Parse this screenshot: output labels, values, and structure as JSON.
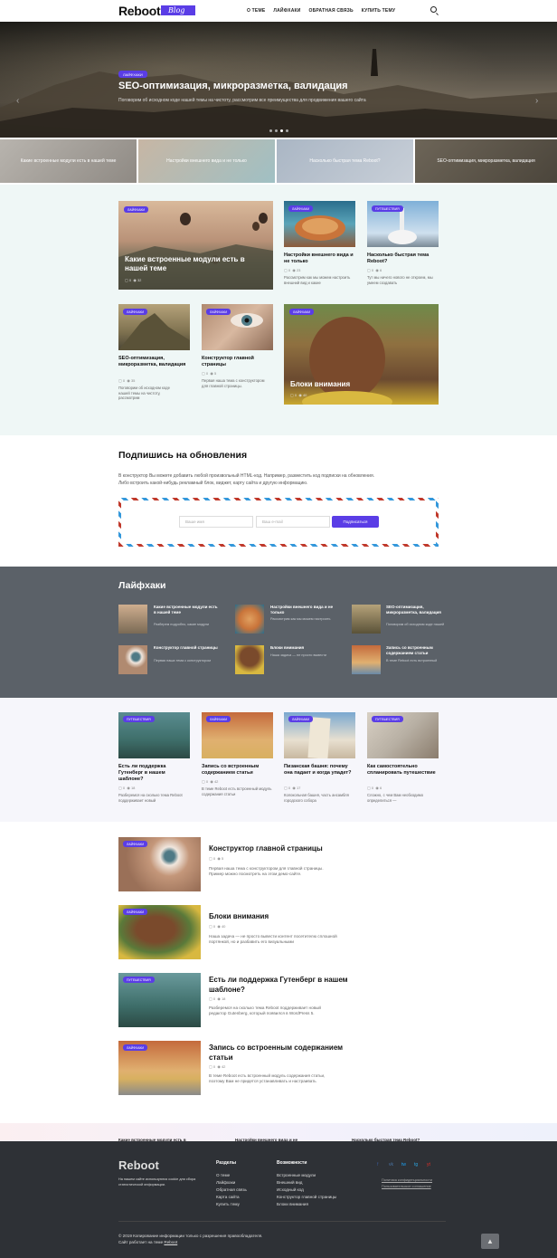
{
  "header": {
    "logo": "Reboot",
    "logo_badge": "Blog",
    "nav": [
      "О теме",
      "Лайфхаки",
      "Обратная связь",
      "Купить тему"
    ]
  },
  "hero": {
    "tag": "Лайфхаки",
    "title": "SEO-оптимизация, микроразметка, валидация",
    "subtitle": "Поговорим об исходном коде нашей темы на чистоту, рассмотрим все преимущества для продвижения вашего сайта",
    "prev": "‹",
    "next": "›"
  },
  "strip": [
    "Какие встроенные модули есть в нашей теме",
    "Настройки внешнего вида и не только",
    "Насколько быстрая тема Reboot?",
    "SEO-оптимизация, микроразметка, валидация"
  ],
  "grid": {
    "big1": {
      "tag": "Лайфхаки",
      "title": "Какие встроенные модули есть в нашей теме",
      "comments": "0",
      "views": "32"
    },
    "c1": {
      "tag": "Лайфхаки",
      "title": "Настройки внешнего вида и не только",
      "comments": "0",
      "views": "23",
      "desc": "Рассмотрим как мы можем настроить внешний вид и какие"
    },
    "c2": {
      "tag": "Путешествия",
      "title": "Насколько быстрая тема Reboot?",
      "comments": "0",
      "views": "6",
      "desc": "Тут мы ничего нового не откроем, мы умеем создавать"
    },
    "c3": {
      "tag": "Лайфхаки",
      "title": "SEO-оптимизация, микроразметка, валидация",
      "comments": "0",
      "views": "35",
      "desc": "Поговорим об исходном коде нашей темы на чистоту, рассмотрим"
    },
    "c4": {
      "tag": "Лайфхаки",
      "title": "Конструктор главной страницы",
      "comments": "0",
      "views": "5",
      "desc": "Первая наша тема с конструктором для главной страницы."
    },
    "big2": {
      "tag": "Лайфхаки",
      "title": "Блоки внимания",
      "comments": "0",
      "views": "40"
    }
  },
  "subscribe": {
    "title": "Подпишись на обновления",
    "text1": "В конструктор Вы можете добавить любой произвольный HTML-код. Например, разместить код подписки на обновления.",
    "text2": "Либо встроить какой-нибудь рекламный блок, виджет, карту сайта и другую информацию.",
    "name_placeholder": "Ваше имя",
    "email_placeholder": "Ваш e-mail",
    "button": "Подписаться"
  },
  "lifehacks": {
    "title": "Лайфхаки",
    "items": [
      {
        "title": "Какие встроенные модули есть в нашей теме",
        "desc": "Разберем подробно, какие модули"
      },
      {
        "title": "Настройки внешнего вида и не только",
        "desc": "Рассмотрим как мы можем настроить"
      },
      {
        "title": "SEO-оптимизация, микроразметка, валидация",
        "desc": "Поговорим об исходном коде нашей"
      },
      {
        "title": "Конструктор главной страницы",
        "desc": "Первая наша тема с конструктором"
      },
      {
        "title": "Блоки внимания",
        "desc": "Наша задача — не просто вывести"
      },
      {
        "title": "Запись со встроенным содержанием статьи",
        "desc": "В теме Reboot есть встроенный"
      }
    ]
  },
  "row4": [
    {
      "tag": "Путешествия",
      "title": "Есть ли поддержка Гутенберг в нашем шаблоне?",
      "comments": "0",
      "views": "18",
      "desc": "Разберемся на сколько тема Reboot поддерживает новый"
    },
    {
      "tag": "Лайфхаки",
      "title": "Запись со встроенным содержанием статьи",
      "comments": "0",
      "views": "42",
      "desc": "В теме Reboot есть встроенный модуль содержания статьи"
    },
    {
      "tag": "Лайфхаки",
      "title": "Пизанская башня: почему она падает и когда упадет?",
      "comments": "0",
      "views": "17",
      "desc": "Колокольная башня, часть ансамбля городского собора"
    },
    {
      "tag": "Путешествия",
      "title": "Как самостоятельно спланировать путешествие",
      "comments": "0",
      "views": "6",
      "desc": "Сложно, с чем Вам необходимо определиться —"
    }
  ],
  "list": [
    {
      "tag": "Лайфхаки",
      "title1": "Конструктор главной страницы",
      "title2": "",
      "comments": "0",
      "views": "5",
      "desc1": "Первая наша тема с конструктором для главной страницы.",
      "desc2": "Пример можно посмотреть на этом демо-сайте."
    },
    {
      "tag": "Лайфхаки",
      "title1": "Блоки внимания",
      "title2": "",
      "comments": "0",
      "views": "40",
      "desc1": "Наша задача — не просто вывести контент посетителю сплошной",
      "desc2": "портянкой, но и разбавить его визуальными"
    },
    {
      "tag": "Путешествия",
      "title1": "Есть ли поддержка Гутенберг в нашем",
      "title2": "шаблоне?",
      "comments": "0",
      "views": "18",
      "desc1": "Разберемся на сколько тема Reboot поддерживает новый",
      "desc2": "редактор Gutenberg, который появился в WordPress 5."
    },
    {
      "tag": "Лайфхаки",
      "title1": "Запись со встроенным содержанием",
      "title2": "статьи",
      "comments": "0",
      "views": "42",
      "desc1": "В теме Reboot есть встроенный модуль содержания статьи,",
      "desc2": "поэтому Вам не придется устанавливать и настраивать"
    }
  ],
  "prefooter": [
    "Какие встроенные модули есть в",
    "Настройки внешнего вида и не",
    "Насколько быстрая тема Reboot?"
  ],
  "footer": {
    "logo": "Reboot",
    "note": "На нашем сайте используются cookie для сбора статистической информации.",
    "col1_title": "Разделы",
    "col1": [
      "О теме",
      "Лайфхаки",
      "Обратная связь",
      "Карта сайта",
      "Купить тему"
    ],
    "col2_title": "Возможности",
    "col2": [
      "Встроенные модули",
      "Внешний вид",
      "Исходный код",
      "Конструктор главной страницы",
      "Блоки внимания"
    ],
    "social": [
      "f",
      "vk",
      "tw",
      "tg",
      "yt"
    ],
    "links": [
      "Политика конфиденциальности",
      "Пользовательское соглашение"
    ],
    "copy1": "© 2019 Копирование информации только с разрешения правообладателя.",
    "copy2_prefix": "Сайт работает на теме ",
    "copy2_link": "Reboot",
    "up": "▲"
  },
  "colors": {
    "accent": "#5a3de6",
    "footer_bg": "#2e3136",
    "gray_bg": "#5b6168",
    "light_bg": "#eff7f6"
  }
}
